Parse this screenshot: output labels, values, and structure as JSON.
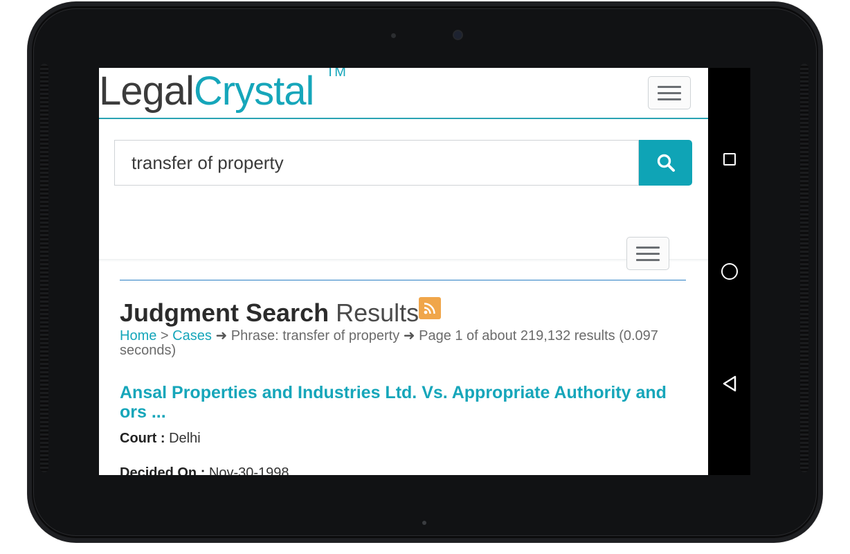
{
  "logo": {
    "part1": "Legal",
    "part2": "Crystal",
    "tm": "TM"
  },
  "search": {
    "value": "transfer of property",
    "button_icon": "search-icon"
  },
  "page": {
    "heading_bold": "Judgment Search",
    "heading_light": "Results",
    "rss_icon": "rss-icon",
    "breadcrumb": {
      "home": "Home",
      "separator1": ">",
      "cases": "Cases",
      "arrow": "➜",
      "phrase": "Phrase: transfer of property",
      "page_info": "Page 1 of about 219,132 results (0.097 seconds)"
    }
  },
  "results": [
    {
      "title": "Ansal Properties and Industries Ltd. Vs. Appropriate Authority and ors ...",
      "court_label": "Court :",
      "court": "Delhi",
      "decided_label": "Decided On :",
      "decided": "Nov-30-1998"
    }
  ],
  "android_nav": {
    "recent": "square-icon",
    "home": "circle-icon",
    "back": "triangle-back-icon"
  },
  "colors": {
    "accent": "#16a6ba",
    "text": "#333333",
    "rss": "#f0a64a",
    "button": "#0fa4b6"
  }
}
